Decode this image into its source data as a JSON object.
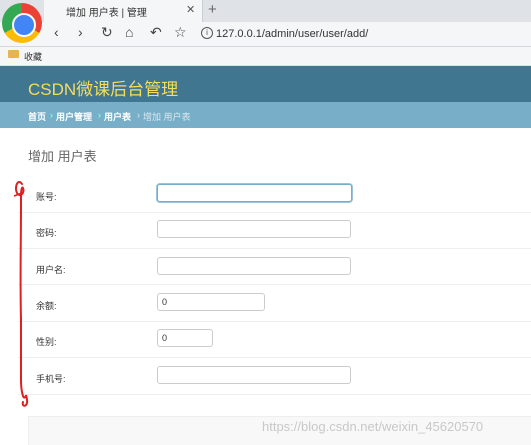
{
  "browser": {
    "tab_title": "增加 用户表 | 管理",
    "tab_close": "✕",
    "new_tab": "+",
    "url": "127.0.0.1/admin/user/user/add/",
    "bookmark_label": "收藏"
  },
  "admin": {
    "brand": "CSDN微课后台管理",
    "breadcrumbs": [
      "首页",
      "用户管理",
      "用户表",
      "增加 用户表"
    ],
    "page_title": "增加 用户表"
  },
  "form": {
    "fields": [
      {
        "label": "账号:",
        "value": ""
      },
      {
        "label": "密码:",
        "value": ""
      },
      {
        "label": "用户名:",
        "value": ""
      },
      {
        "label": "余额:",
        "value": "0"
      },
      {
        "label": "性别:",
        "value": "0"
      },
      {
        "label": "手机号:",
        "value": ""
      }
    ]
  },
  "watermark": "https://blog.csdn.net/weixin_45620570",
  "colors": {
    "header_bg": "#417690",
    "brand_text": "#f5dd5d",
    "breadcrumb_bg": "#79aec8",
    "annotation": "#e02020"
  }
}
